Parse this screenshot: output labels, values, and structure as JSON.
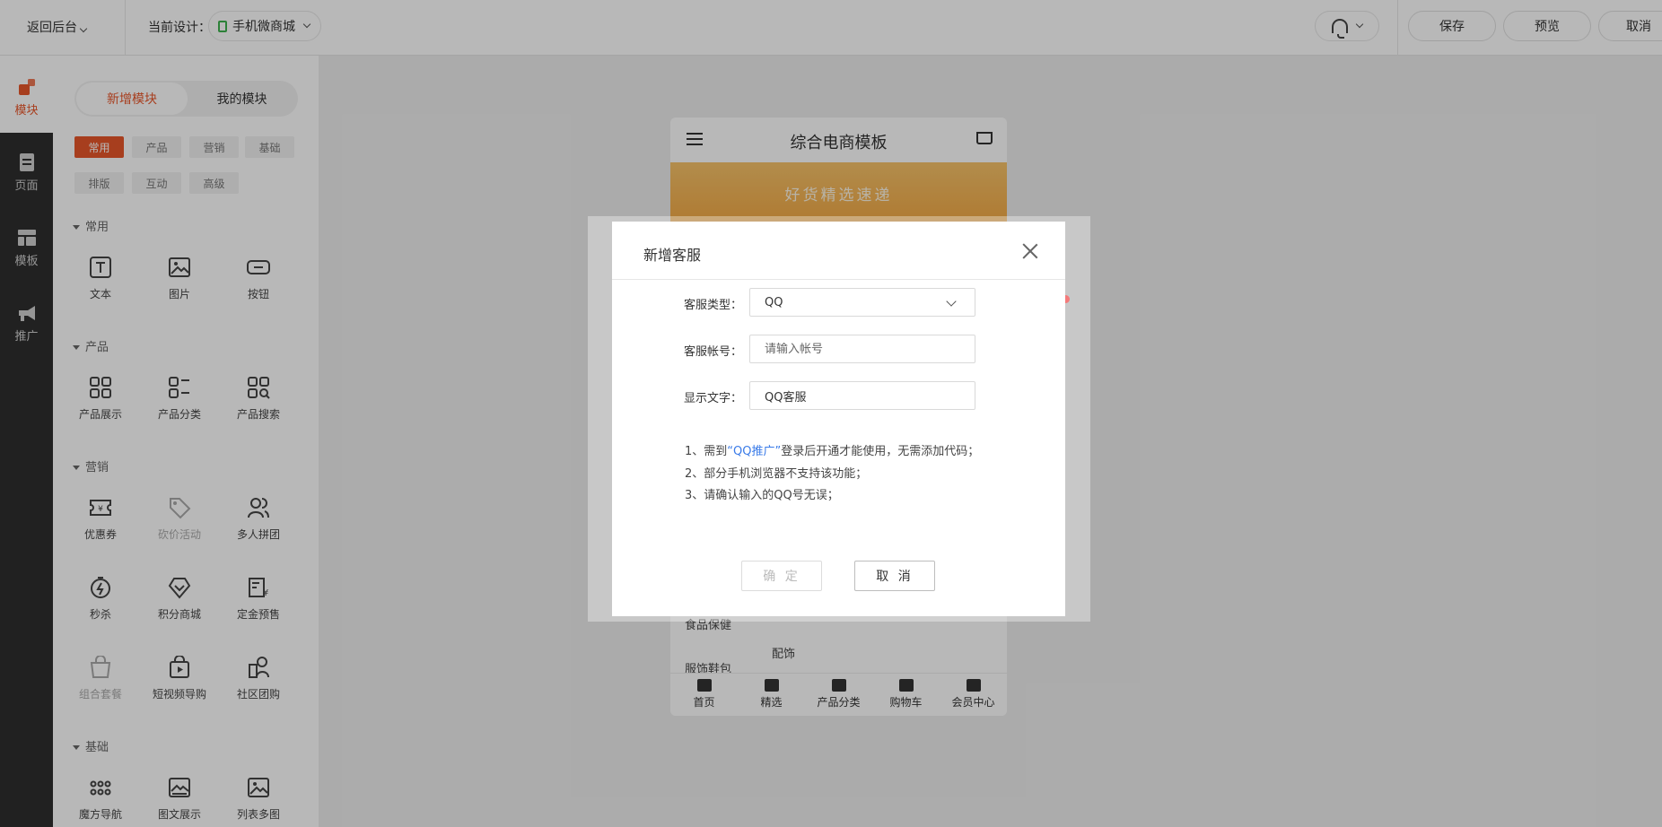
{
  "topbar": {
    "back_label": "返回后台",
    "current_design_label": "当前设计：",
    "design_name": "手机微商城",
    "save_label": "保存",
    "preview_label": "预览",
    "cancel_label": "取消"
  },
  "rail": {
    "items": [
      {
        "label": "模块",
        "icon": "module-icon"
      },
      {
        "label": "页面",
        "icon": "page-icon"
      },
      {
        "label": "模板",
        "icon": "template-icon"
      },
      {
        "label": "推广",
        "icon": "promote-icon"
      }
    ]
  },
  "panel": {
    "tabs": [
      "新增模块",
      "我的模块"
    ],
    "categories": [
      "常用",
      "产品",
      "营销",
      "基础",
      "排版",
      "互动",
      "高级"
    ],
    "sections": {
      "common": {
        "title": "常用",
        "modules": [
          "文本",
          "图片",
          "按钮"
        ]
      },
      "product": {
        "title": "产品",
        "modules": [
          "产品展示",
          "产品分类",
          "产品搜索"
        ]
      },
      "marketing": {
        "title": "营销",
        "modules": [
          "优惠券",
          "砍价活动",
          "多人拼团",
          "秒杀",
          "积分商城",
          "定金预售",
          "组合套餐",
          "短视频导购",
          "社区团购"
        ]
      },
      "basic": {
        "title": "基础",
        "modules": [
          "魔方导航",
          "图文展示",
          "列表多图"
        ]
      }
    }
  },
  "phone": {
    "title": "综合电商模板",
    "banner_text": "好货精选速递",
    "category_1": "食品保健",
    "category_2": "服饰鞋包",
    "sub_category": "配饰",
    "tabs": [
      "首页",
      "精选",
      "产品分类",
      "购物车",
      "会员中心"
    ]
  },
  "modal": {
    "title": "新增客服",
    "type_label": "客服类型：",
    "type_value": "QQ",
    "account_label": "客服帐号：",
    "account_placeholder": "请输入帐号",
    "display_label": "显示文字：",
    "display_value": "QQ客服",
    "note_1_prefix": "1、需到",
    "note_1_link": "“QQ推广”",
    "note_1_suffix": "登录后开通才能使用，无需添加代码；",
    "note_2": "2、部分手机浏览器不支持该功能；",
    "note_3": "3、请确认输入的QQ号无误；",
    "ok_label": "确 定",
    "cancel_label": "取 消"
  }
}
